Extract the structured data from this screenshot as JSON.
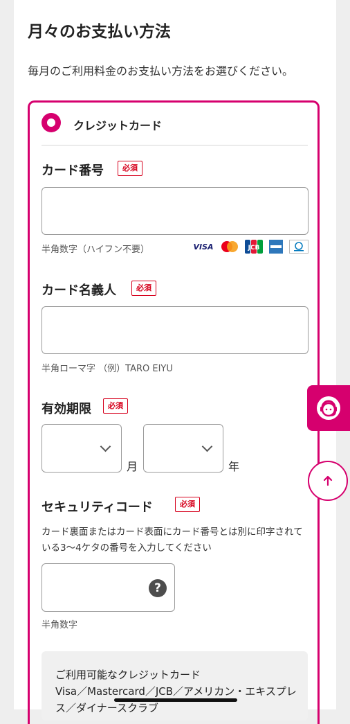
{
  "page": {
    "title": "月々のお支払い方法",
    "intro": "毎月のご利用料金のお支払い方法をお選びください。"
  },
  "payment_option": {
    "label": "クレジットカード",
    "selected": true
  },
  "required_badge": "必須",
  "card_number": {
    "label": "カード番号",
    "hint": "半角数字（ハイフン不要）",
    "value": ""
  },
  "card_holder": {
    "label": "カード名義人",
    "hint": "半角ローマ字 （例）TARO EIYU",
    "value": ""
  },
  "expiry": {
    "label": "有効期限",
    "month_unit": "月",
    "year_unit": "年",
    "month_value": "",
    "year_value": ""
  },
  "security_code": {
    "label": "セキュリティコード",
    "description": "カード裏面またはカード表面にカード番号とは別に印字されている3〜4ケタの番号を入力してください",
    "hint": "半角数字",
    "help": "?"
  },
  "brands": {
    "visa": "VISA",
    "jcb": "JCB",
    "amex": "AMERICAN EXPRESS",
    "diners": "Diners Club"
  },
  "info_box": {
    "heading": "ご利用可能なクレジットカード",
    "body": "Visa／Mastercard／JCB／アメリカン・エキスプレス／ダイナースクラブ"
  },
  "colors": {
    "accent": "#d6006e",
    "required": "#d6001c"
  }
}
